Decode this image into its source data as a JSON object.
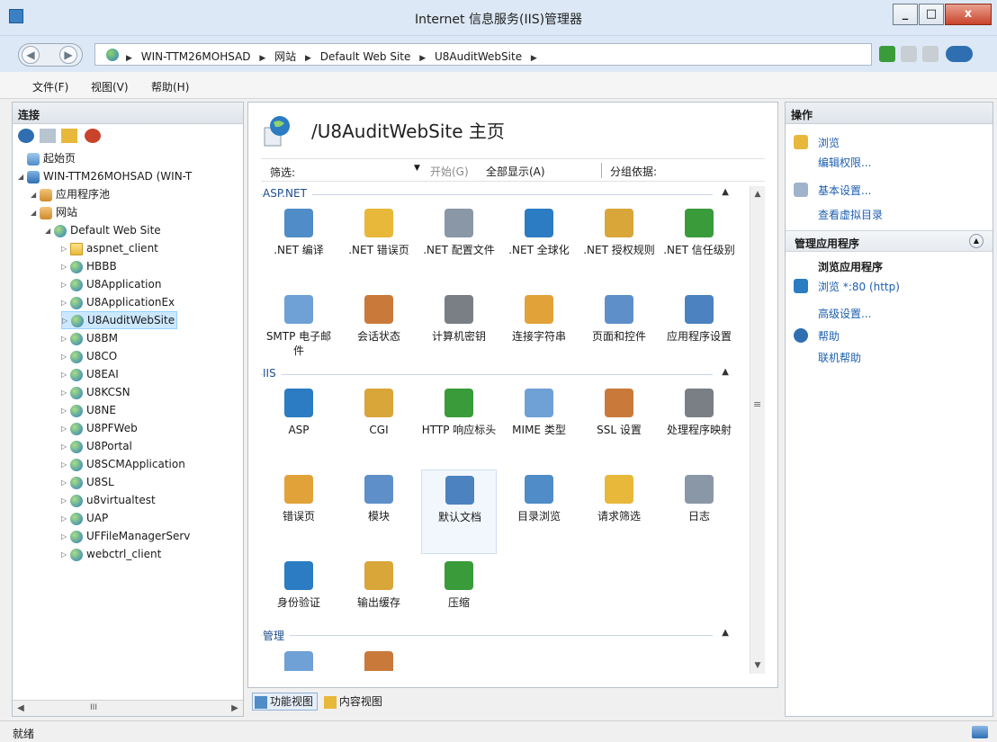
{
  "window": {
    "title": "Internet 信息服务(IIS)管理器",
    "min": "_",
    "max": "□",
    "close": "x"
  },
  "address": {
    "crumbs": [
      "WIN-TTM26MOHSAD",
      "网站",
      "Default Web Site",
      "U8AuditWebSite"
    ],
    "sep": "▶"
  },
  "menu": [
    "文件(F)",
    "视图(V)",
    "帮助(H)"
  ],
  "left": {
    "header": "连接",
    "tree": [
      {
        "label": "起始页",
        "icon": "start-page-icon",
        "level": 0
      },
      {
        "label": "WIN-TTM26MOHSAD (WIN-T",
        "icon": "server-icon",
        "level": 0
      },
      {
        "label": "应用程序池",
        "icon": "app-pool-icon",
        "level": 1
      },
      {
        "label": "网站",
        "icon": "sites-folder-icon",
        "level": 1
      },
      {
        "label": "Default Web Site",
        "icon": "site-icon",
        "level": 2
      },
      {
        "label": "aspnet_client",
        "icon": "folder-icon",
        "level": 3
      },
      {
        "label": "HBBB",
        "icon": "app-icon",
        "level": 3
      },
      {
        "label": "U8Application",
        "icon": "app-icon",
        "level": 3
      },
      {
        "label": "U8ApplicationEx",
        "icon": "app-icon",
        "level": 3
      },
      {
        "label": "U8AuditWebSite",
        "icon": "app-icon",
        "level": 3,
        "selected": true
      },
      {
        "label": "U8BM",
        "icon": "app-icon",
        "level": 3
      },
      {
        "label": "U8CO",
        "icon": "app-icon",
        "level": 3
      },
      {
        "label": "U8EAI",
        "icon": "app-icon",
        "level": 3
      },
      {
        "label": "U8KCSN",
        "icon": "app-icon",
        "level": 3
      },
      {
        "label": "U8NE",
        "icon": "app-icon",
        "level": 3
      },
      {
        "label": "U8PFWeb",
        "icon": "app-icon",
        "level": 3
      },
      {
        "label": "U8Portal",
        "icon": "app-icon",
        "level": 3
      },
      {
        "label": "U8SCMApplication",
        "icon": "app-icon",
        "level": 3
      },
      {
        "label": "U8SL",
        "icon": "app-icon",
        "level": 3
      },
      {
        "label": "u8virtualtest",
        "icon": "app-icon",
        "level": 3
      },
      {
        "label": "UAP",
        "icon": "app-icon",
        "level": 3
      },
      {
        "label": "UFFileManagerServ",
        "icon": "app-icon",
        "level": 3
      },
      {
        "label": "webctrl_client",
        "icon": "app-icon",
        "level": 3
      }
    ],
    "hscroll_mid": "III"
  },
  "center": {
    "title": "/U8AuditWebSite 主页",
    "filter_label": "筛选:",
    "go": "开始(G)",
    "show_all": "全部显示(A)",
    "group_by": "分组依据:",
    "sections": [
      {
        "name": "ASP.NET",
        "features": [
          ".NET 编译",
          ".NET 错误页",
          ".NET 配置文件",
          ".NET 全球化",
          ".NET 授权规则",
          ".NET 信任级别",
          "SMTP 电子邮件",
          "会话状态",
          "计算机密钥",
          "连接字符串",
          "页面和控件",
          "应用程序设置"
        ]
      },
      {
        "name": "IIS",
        "features": [
          "ASP",
          "CGI",
          "HTTP 响应标头",
          "MIME 类型",
          "SSL 设置",
          "处理程序映射",
          "错误页",
          "模块",
          "默认文档",
          "目录浏览",
          "请求筛选",
          "日志",
          "身份验证",
          "输出缓存",
          "压缩"
        ]
      },
      {
        "name": "管理",
        "features": [
          "",
          ""
        ]
      }
    ],
    "view_tabs": [
      "功能视图",
      "内容视图"
    ]
  },
  "right": {
    "header": "操作",
    "actions": [
      "浏览",
      "编辑权限...",
      "基本设置...",
      "查看虚拟目录"
    ],
    "manage_header": "管理应用程序",
    "browse_app": "浏览应用程序",
    "browse_http": "浏览 *:80 (http)",
    "advanced": "高级设置...",
    "help": "帮助",
    "online_help": "联机帮助"
  },
  "status": {
    "text": "就绪"
  },
  "colors": {
    "link": "#1c5fb0",
    "section": "#1e4e8c",
    "selected": "#cce8ff"
  }
}
